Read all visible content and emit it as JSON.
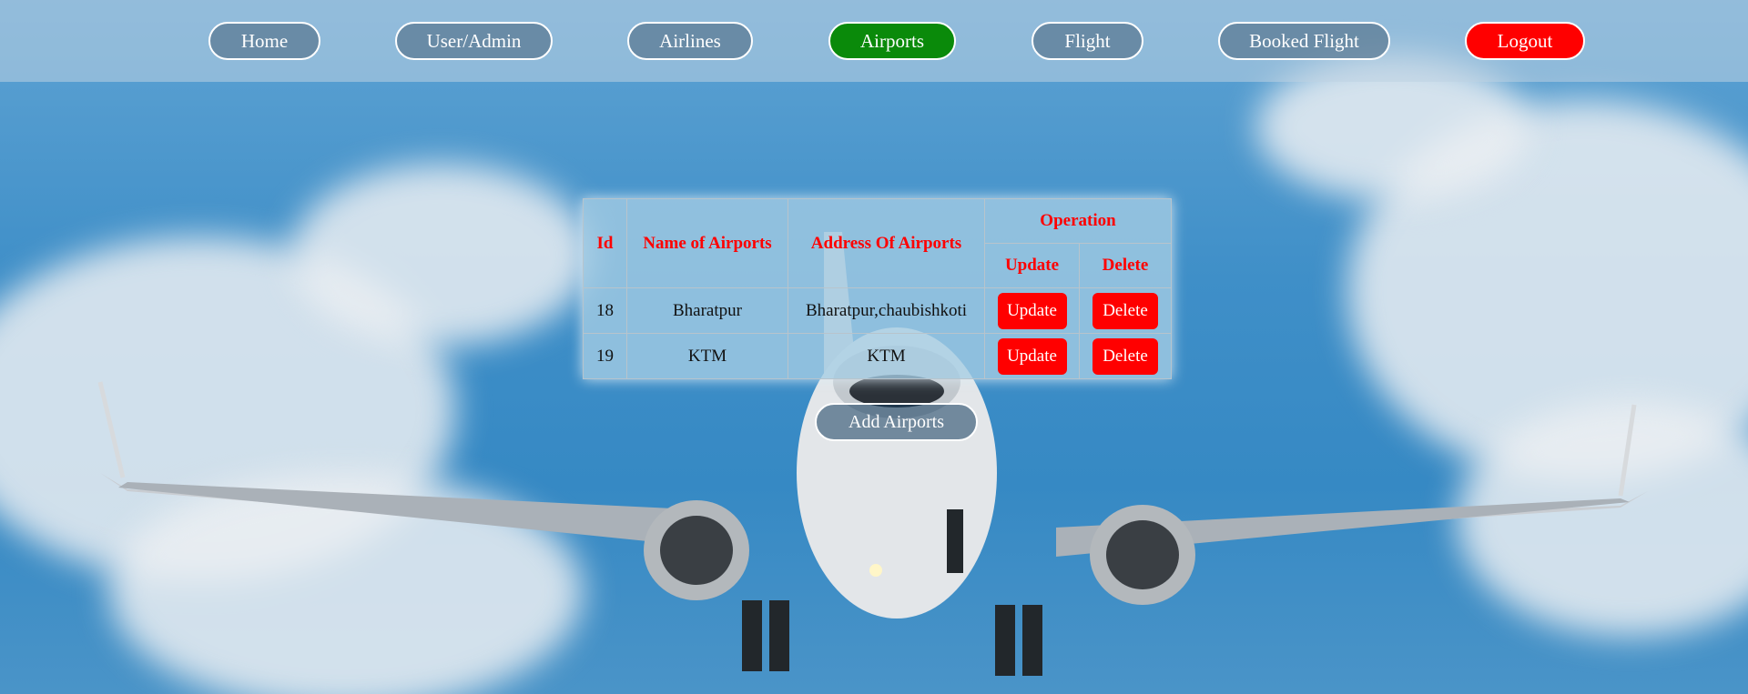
{
  "nav": {
    "home": "Home",
    "user_admin": "User/Admin",
    "airlines": "Airlines",
    "airports": "Airports",
    "flight": "Flight",
    "booked_flight": "Booked Flight",
    "logout": "Logout"
  },
  "table": {
    "headers": {
      "id": "Id",
      "name": "Name of Airports",
      "address": "Address Of Airports",
      "operation": "Operation",
      "update": "Update",
      "delete": "Delete"
    },
    "rows": [
      {
        "id": "18",
        "name": "Bharatpur",
        "address": "Bharatpur,chaubishkoti",
        "update": "Update",
        "delete": "Delete"
      },
      {
        "id": "19",
        "name": "KTM",
        "address": "KTM",
        "update": "Update",
        "delete": "Delete"
      }
    ]
  },
  "add_button": "Add Airports",
  "colors": {
    "accent_active": "#0a8a0a",
    "danger": "#ff0000",
    "header_text": "#ff0000"
  }
}
